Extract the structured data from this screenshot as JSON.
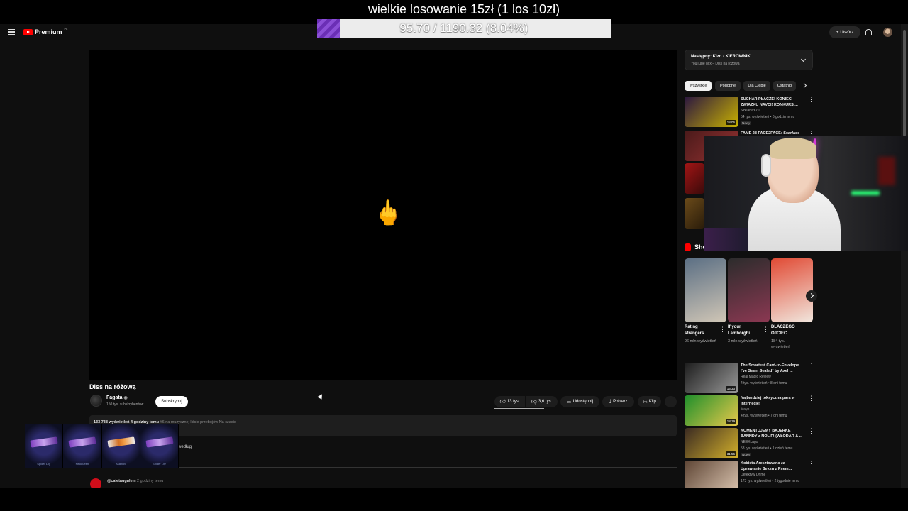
{
  "overlay": {
    "title": "wielkie losowanie 15zł (1 los 10zł)",
    "progress_text": "95.70 / 1190.32 (8.04%)",
    "progress_fraction": 0.0804
  },
  "header": {
    "logo": "Premium",
    "logo_region": "PL",
    "create_label": "Utwórz"
  },
  "video": {
    "emoji": "🖕",
    "title": "Diss na różową",
    "channel": "Fagata",
    "subscribers": "150 tys. subskrybentów",
    "subscribe_label": "Subskrybuj",
    "likes": "13 tys.",
    "dislikes": "3,6 tys.",
    "share_label": "Udostępnij",
    "download_label": "Pobierz",
    "clip_label": "Klip",
    "description_stats": "133 738 wyświetleń  4 godziny temu",
    "description_tags": "#6 na muzycznej liście przebojów Na czasie",
    "sort_text": "według",
    "comment_author": "@caletaugulem",
    "comment_time": "2 godziny temu"
  },
  "skins": [
    {
      "label": "Spider Lily",
      "style": "purple"
    },
    {
      "label": "Neoqueen",
      "style": "purple"
    },
    {
      "label": "Asiimov",
      "style": "orange"
    },
    {
      "label": "Spider Lily",
      "style": "purple"
    }
  ],
  "sidebar": {
    "next_title": "Następny: Kizo - KIEROWNIK",
    "next_sub": "YouTube Mix – Diss na różową",
    "chips": [
      "Wszystkie",
      "Podobne",
      "Dla Ciebie",
      "Ostatnio"
    ],
    "recommendations_top": [
      {
        "title": "SUCHAR PŁACZE! KONIEC ZWIĄZKU NAVCI! KONKURS ...",
        "channel": "SzklanaYZJ",
        "meta": "54 tys. wyświetleń • 6 godzin temu",
        "badge": "Nowy",
        "duration": "18:06",
        "colors": [
          "#2b1640",
          "#c9b200"
        ]
      },
      {
        "title": "FAME 28 FACE2FACE: Scarface",
        "channel": "",
        "meta": "",
        "badge": "",
        "duration": "",
        "colors": [
          "#4a1a1a",
          "#933"
        ]
      }
    ],
    "shorts_label": "Shorts",
    "shorts": [
      {
        "title": "Rating strangers ...",
        "views": "96 mln wyświetleń",
        "colors": [
          "#5b6f84",
          "#d0c6b6"
        ]
      },
      {
        "title": "If your Lamborghi...",
        "views": "3 mln wyświetleń",
        "colors": [
          "#2c2c2c",
          "#8b3852"
        ]
      },
      {
        "title": "DLACZEGO OJCIEC ...",
        "views": "184 tys. wyświetleń",
        "colors": [
          "#e14a34",
          "#f1e6dd"
        ]
      }
    ],
    "recommendations": [
      {
        "title": "The Smartest Card-to-Envelope I've Seen. Sealed* by Axel ...",
        "channel": "Real Magic Review",
        "meta": "4 tys. wyświetleń • 8 dni temu",
        "badge": "",
        "duration": "15:33",
        "colors": [
          "#1d1d1d",
          "#999"
        ]
      },
      {
        "title": "Najbardziej toksyczna para w internecie!",
        "channel": "Mayo",
        "meta": "4 tys. wyświetleń • 7 dni temu",
        "badge": "",
        "duration": "18:19",
        "colors": [
          "#1e8f2b",
          "#e8c94b"
        ]
      },
      {
        "title": "KOMENTUJEMY BAJERKE BANNDY z NOLIF! (WŁODAR & ...",
        "channel": "NEEXcago",
        "meta": "53 tys. wyświetleń • 1 dzień temu",
        "badge": "Nowy",
        "duration": "31:56",
        "colors": [
          "#3a2a22",
          "#d4b12b"
        ]
      },
      {
        "title": "Kobieta Aresztowana za Uprawianie Seksu z Psem...",
        "channel": "Detektyw Drime",
        "meta": "173 tys. wyświetleń • 2 tygodnie temu",
        "badge": "",
        "duration": "",
        "colors": [
          "#5e4535",
          "#d8c2ad"
        ]
      }
    ]
  }
}
